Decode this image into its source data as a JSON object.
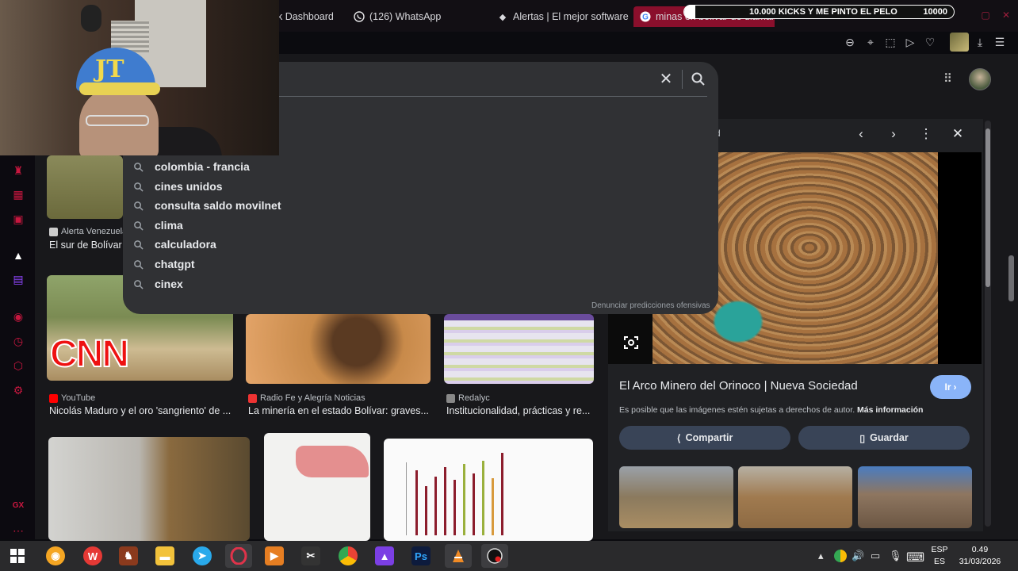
{
  "tabs": [
    {
      "label": "k Dashboard"
    },
    {
      "label": "(126) WhatsApp"
    },
    {
      "label": "Alertas | El mejor software"
    },
    {
      "label": "minas en bolivar de diamantes"
    }
  ],
  "overlay": {
    "title": "10.000 KICKS Y ME PINTO EL PELO",
    "goal": "10000"
  },
  "suggestions": [
    "colombia - francia",
    "cines unidos",
    "consulta saldo movilnet",
    "clima",
    "calculadora",
    "chatgpt",
    "cinex"
  ],
  "report_link": "Denunciar predicciones ofensivas",
  "results": [
    {
      "source": "Alerta Venezuela",
      "title": "El sur de Bolívar"
    },
    {
      "source": "YouTube",
      "title": "Nicolás Maduro y el oro 'sangriento' de ..."
    },
    {
      "source": "Radio Fe y Alegría Noticias",
      "title": "La minería en el estado Bolívar: graves..."
    },
    {
      "source": "Redalyc",
      "title": "Institucionalidad, prácticas y re..."
    }
  ],
  "cnn_logo": "CNN",
  "preview": {
    "header_fragment": "d",
    "title": "El Arco Minero del Orinoco | Nueva Sociedad",
    "go_label": "Ir",
    "note": "Es posible que las imágenes estén sujetas a derechos de autor.",
    "note_link": "Más información",
    "share_label": "Compartir",
    "save_label": "Guardar"
  },
  "sidebar_bottom": {
    "gx": "GX"
  },
  "tray": {
    "lang": "ESP",
    "layout": "ES",
    "time": "0.49",
    "date": "31/03/2026"
  },
  "colors": {
    "opera_red": "#c8173f",
    "active_tab": "#8a0f2c",
    "go_button": "#8ab4f8",
    "panel": "#303134"
  }
}
